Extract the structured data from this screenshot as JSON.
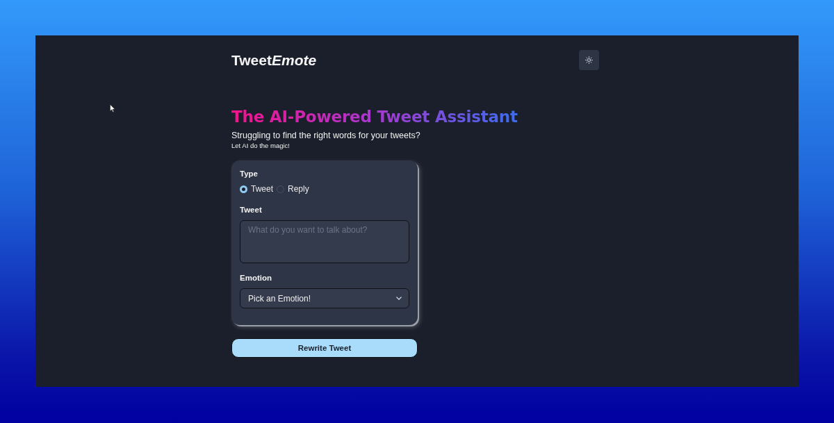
{
  "header": {
    "logo": {
      "text": "Tweet",
      "emphasis": "Emote"
    }
  },
  "hero": {
    "title": "The AI-Powered Tweet Assistant",
    "subtitle": "Struggling to find the right words for your tweets?",
    "tagline": "Let AI do the magic!"
  },
  "form": {
    "type": {
      "label": "Type",
      "options": [
        {
          "label": "Tweet",
          "selected": true
        },
        {
          "label": "Reply",
          "selected": false
        }
      ]
    },
    "tweet": {
      "label": "Tweet",
      "placeholder": "What do you want to talk about?"
    },
    "emotion": {
      "label": "Emotion",
      "value": "Pick an Emotion!"
    }
  },
  "submit": {
    "label": "Rewrite Tweet"
  }
}
